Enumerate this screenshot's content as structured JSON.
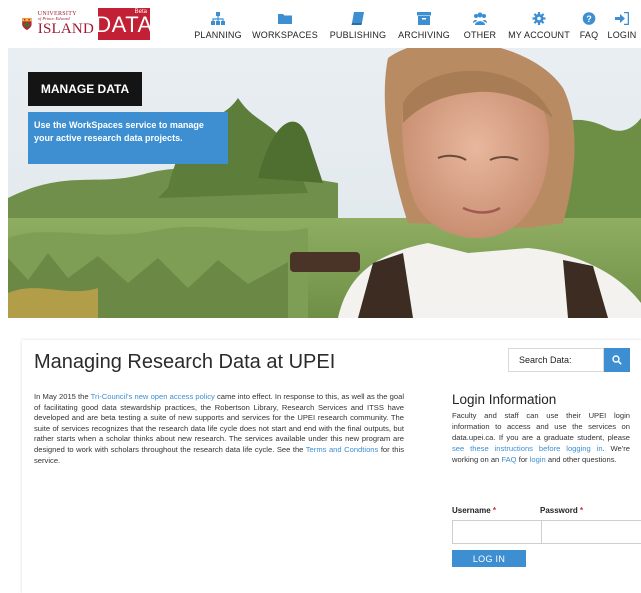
{
  "logo": {
    "line1": "UNIVERSITY",
    "line2": "of Prince Edward",
    "line3": "ISLAND",
    "data": "DATA",
    "beta": "Beta"
  },
  "nav": [
    {
      "label": "PLANNING",
      "icon": "sitemap-icon"
    },
    {
      "label": "WORKSPACES",
      "icon": "folder-icon"
    },
    {
      "label": "PUBLISHING",
      "icon": "book-icon"
    },
    {
      "label": "ARCHIVING",
      "icon": "archive-icon"
    },
    {
      "label": "OTHER",
      "icon": "users-icon"
    },
    {
      "label": "MY ACCOUNT",
      "icon": "gear-icon"
    },
    {
      "label": "FAQ",
      "icon": "question-icon"
    },
    {
      "label": "LOGIN",
      "icon": "sign-in-icon"
    }
  ],
  "hero": {
    "title": "MANAGE DATA",
    "description": "Use the WorkSpaces service to manage your active research data projects."
  },
  "main": {
    "title": "Managing Research Data at UPEI",
    "search_label": "Search Data:",
    "intro": {
      "p1": "In May 2015 the ",
      "link1": "Tri-Council's new open access policy",
      "p2": " came into effect. In response to this, as well as the goal of facilitating good data stewardship practices, the Robertson Library, Research Services and ITSS have developed and are beta testing a suite of new supports and services for the UPEI research community. The suite of services recognizes that the research data life cycle does not start and end with the final outputs, but rather starts when a scholar thinks about new research. The services available under this new program are designed to work with scholars throughout the research data life cycle.  See the ",
      "link2": "Terms and Condtions",
      "p3": " for this service."
    }
  },
  "login": {
    "title": "Login Information",
    "t1": "Faculty and staff can use their UPEI login information to access and use the services on data.upei.ca.  If you are a graduate student, please ",
    "link1": "see these instructions before logging in",
    "t2": ". We're working on an ",
    "link2": "FAQ",
    "t3": " for ",
    "link3": "login",
    "t4": " and other questions.",
    "username_label": "Username",
    "password_label": "Password",
    "required_mark": "*",
    "button": "LOG IN"
  },
  "colors": {
    "accent": "#3d8fd1",
    "brand_red": "#c22034",
    "nav_icon": "#3d8fd1",
    "dark_label": "#141414"
  }
}
